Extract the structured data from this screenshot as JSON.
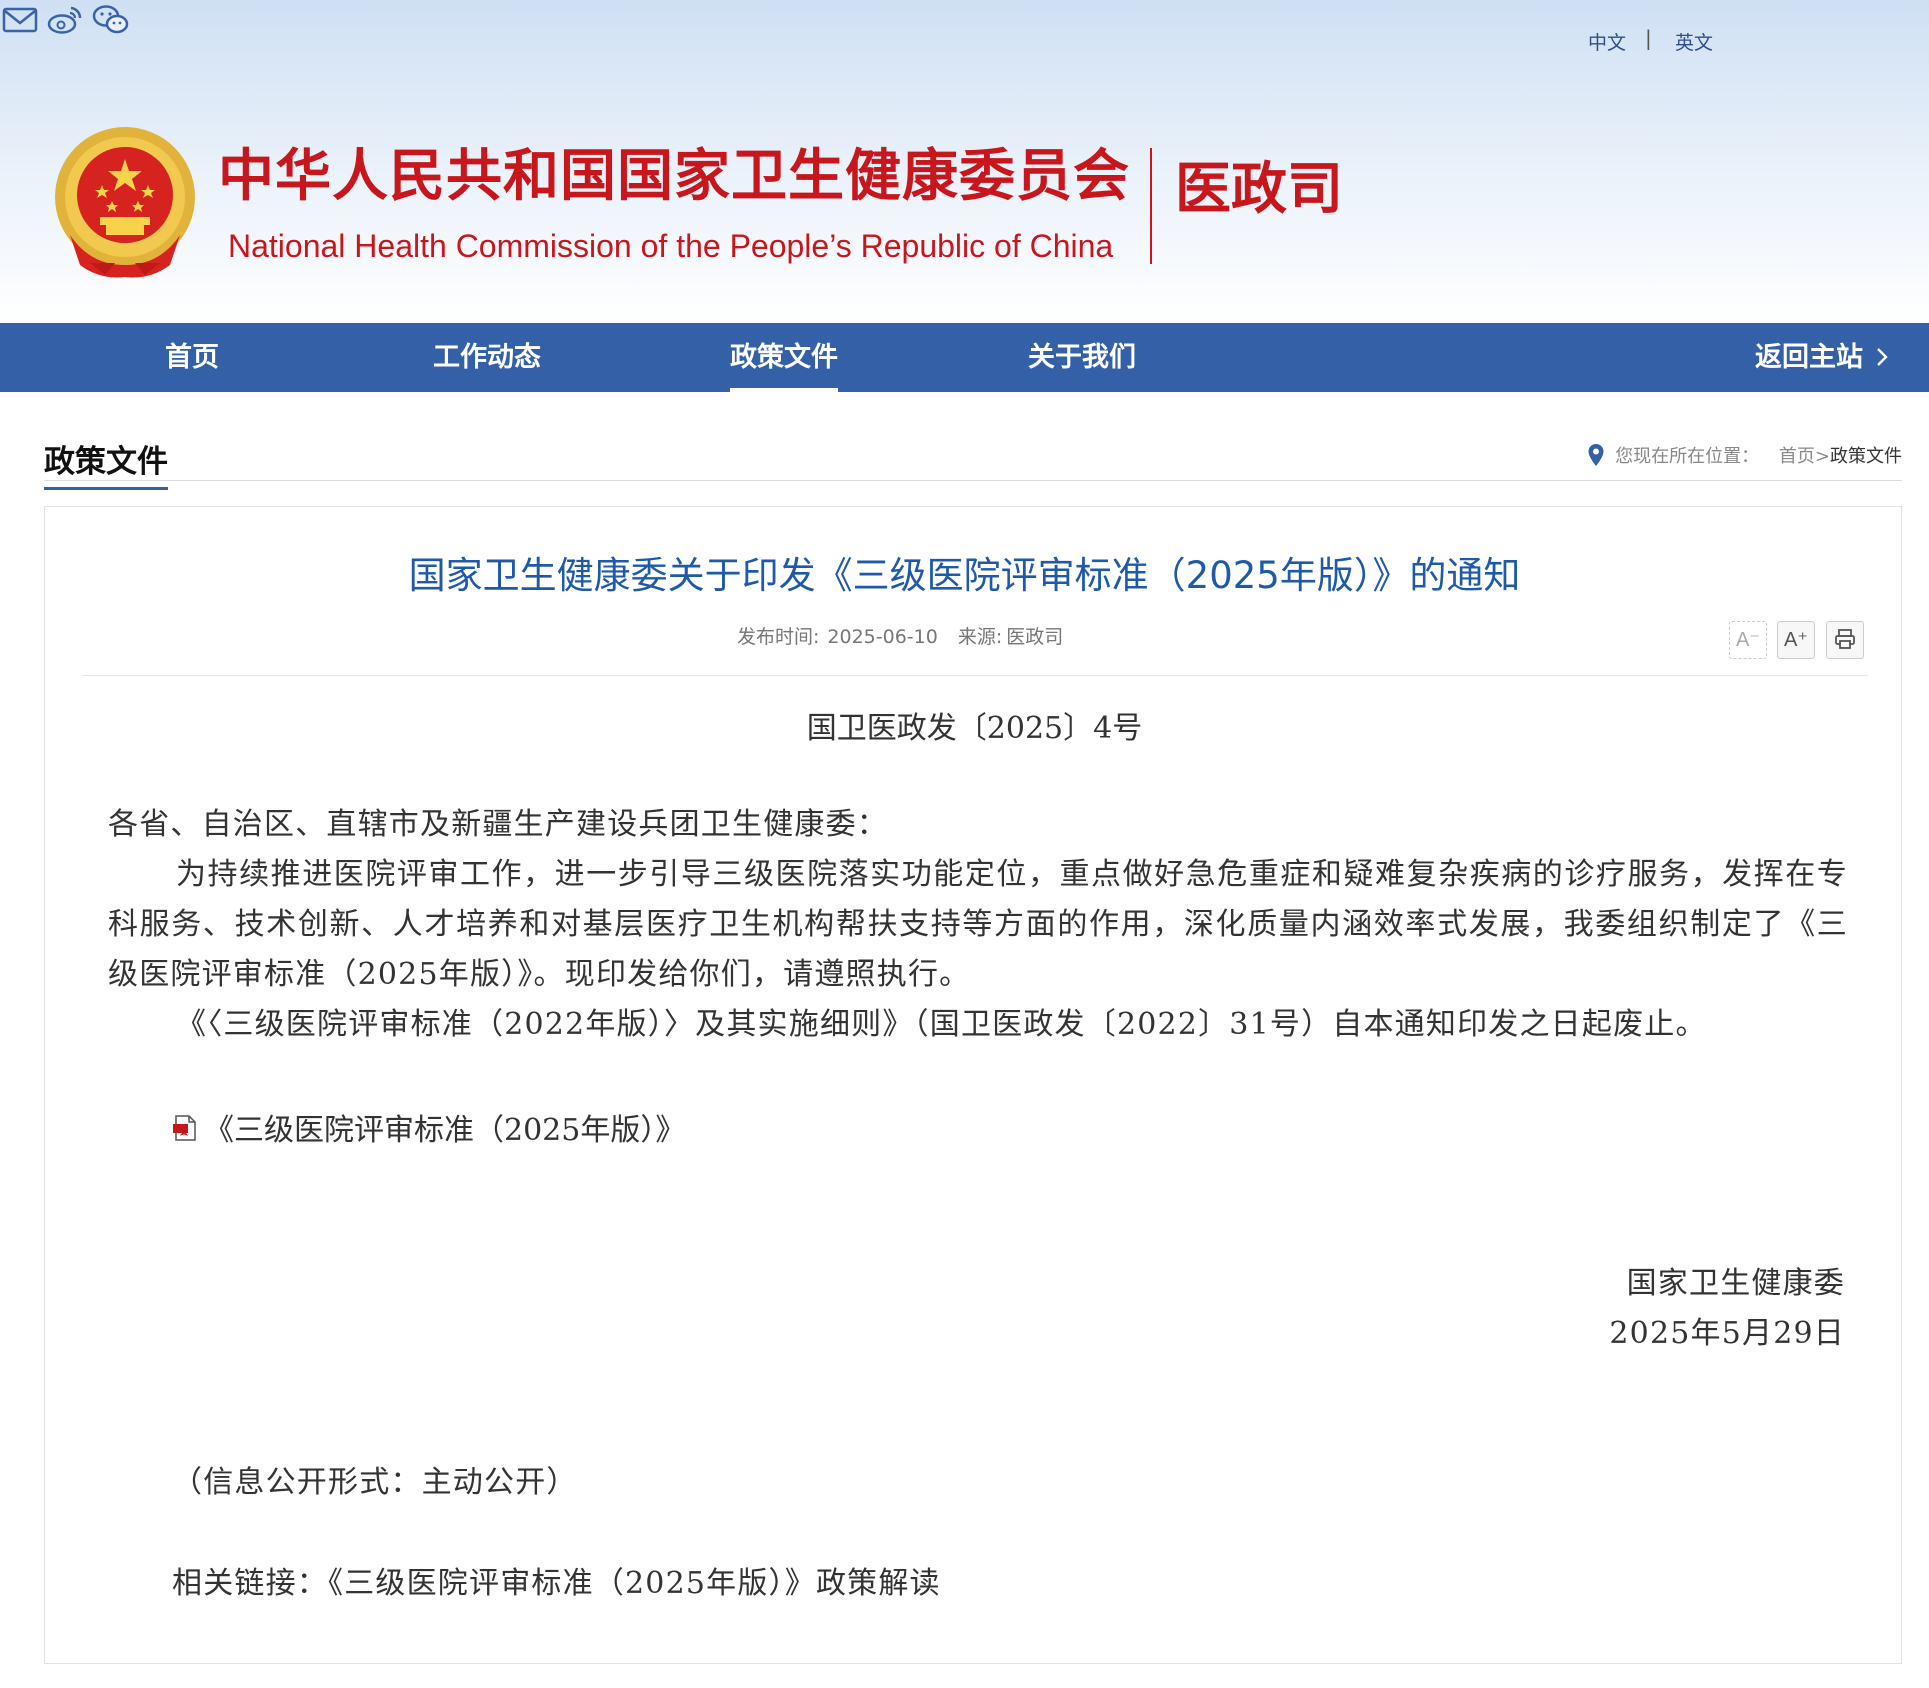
{
  "header": {
    "site_name_cn": "中华人民共和国国家卫生健康委员会",
    "site_name_en": "National Health Commission of the People’s  Republic of China",
    "department": "医政司",
    "top_links": {
      "mail_icon": "mail-icon",
      "weibo_icon": "weibo-icon",
      "wechat_icon": "wechat-icon",
      "lang_cn": "中文",
      "lang_separator": "|",
      "lang_en": "英文"
    }
  },
  "nav": {
    "items": [
      {
        "label": "首页",
        "active": false
      },
      {
        "label": "工作动态",
        "active": false
      },
      {
        "label": "政策文件",
        "active": true
      },
      {
        "label": "关于我们",
        "active": false
      }
    ],
    "back_home": "返回主站"
  },
  "section": {
    "title": "政策文件",
    "breadcrumb_prefix": "您现在所在位置：",
    "breadcrumb_home": "首页",
    "breadcrumb_sep": ">",
    "breadcrumb_current": "政策文件"
  },
  "article": {
    "title": "国家卫生健康委关于印发《三级医院评审标准（2025年版）》的通知",
    "publish_label": "发布时间:",
    "publish_date": "2025-06-10",
    "source_label": "来源:",
    "source": "医政司",
    "tools": {
      "font_smaller": "A⁻",
      "font_larger": "A⁺",
      "print_icon": "print-icon"
    },
    "doc_number": "国卫医政发〔2025〕4号",
    "greeting": "各省、自治区、直辖市及新疆生产建设兵团卫生健康委：",
    "main_paragraph": "为持续推进医院评审工作，进一步引导三级医院落实功能定位，重点做好急危重症和疑难复杂疾病的诊疗服务，发挥在专科服务、技术创新、人才培养和对基层医疗卫生机构帮扶支持等方面的作用，深化质量内涵效率式发展，我委组织制定了《三级医院评审标准（2025年版）》。现印发给你们，请遵照执行。",
    "repeal_paragraph": "《〈三级医院评审标准（2022年版）〉及其实施细则》（国卫医政发〔2022〕31号）自本通知印发之日起废止。",
    "attachment": "《三级医院评审标准（2025年版）》",
    "signature_org": "国家卫生健康委",
    "signature_date": "2025年5月29日",
    "disclosure": "（信息公开形式：主动公开）",
    "related_links": "相关链接：《三级医院评审标准（2025年版）》政策解读"
  },
  "colors": {
    "brand_red": "#c8161d",
    "nav_blue": "#3460a8",
    "title_blue": "#1f5aaa"
  }
}
